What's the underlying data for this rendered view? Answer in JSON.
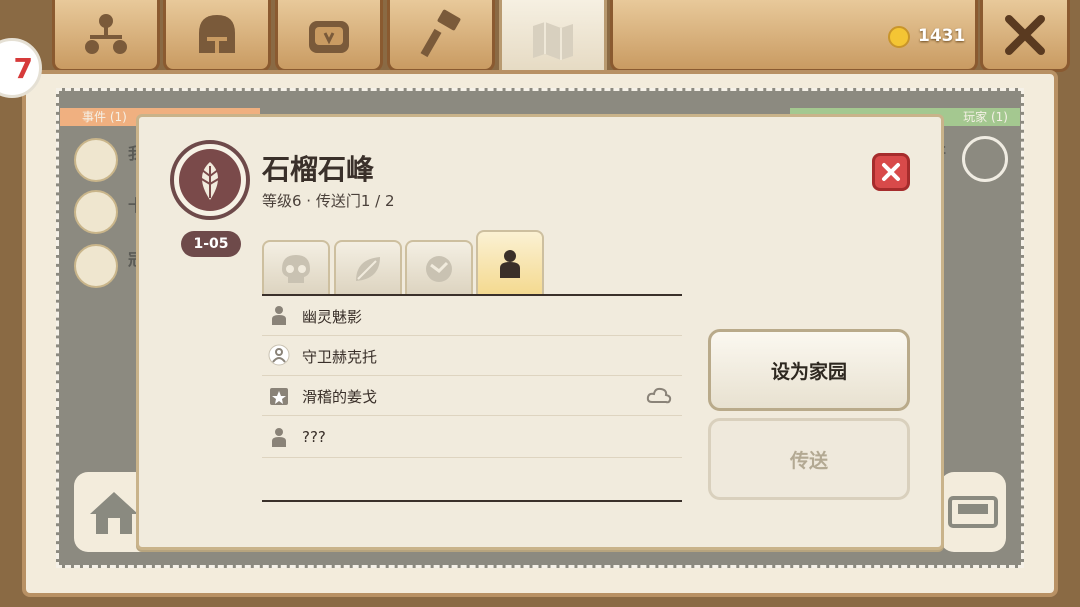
{
  "top_bar": {
    "tabs": [
      {
        "icon": "tree-icon"
      },
      {
        "icon": "helmet-icon"
      },
      {
        "icon": "bag-icon"
      },
      {
        "icon": "hammer-icon"
      },
      {
        "icon": "map-icon"
      }
    ],
    "coins": "1431",
    "close_icon": "close-x-icon"
  },
  "badge_left": "7",
  "background_panel": {
    "left_header": "事件 (1)",
    "right_header": "玩家 (1)",
    "rows": [
      "我",
      "十",
      "冠"
    ],
    "right_row": "哥"
  },
  "dialog": {
    "title": "石榴石峰",
    "subtitle": "等级6 · 传送门1 / 2",
    "level_badge": "1-05",
    "tabs": [
      {
        "icon": "skull-icon"
      },
      {
        "icon": "leaf-icon"
      },
      {
        "icon": "beast-icon"
      },
      {
        "icon": "person-icon",
        "active": true
      }
    ],
    "npcs": [
      {
        "name": "幽灵魅影",
        "icon": "person-icon"
      },
      {
        "name": "守卫赫克托",
        "icon": "guard-icon"
      },
      {
        "name": "滑稽的姜戈",
        "icon": "quest-icon",
        "extra_icon": "cloud-icon"
      },
      {
        "name": "???",
        "icon": "person-icon"
      }
    ],
    "buttons": {
      "set_home": "设为家园",
      "teleport": "传送"
    }
  },
  "colors": {
    "accent_brown": "#6e4a4a",
    "close_red": "#d84a4a",
    "wood": "#c99b62"
  }
}
